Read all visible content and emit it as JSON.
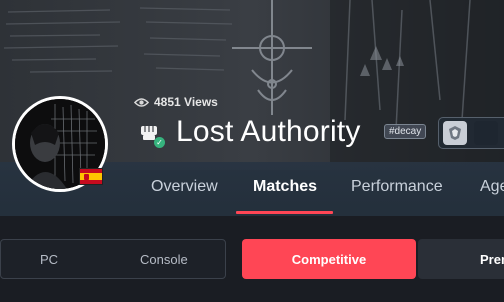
{
  "profile": {
    "views_count": "4851 Views",
    "player_name": "Lost Authority",
    "tag": "#decay",
    "flag_country": "Spain",
    "verified": true
  },
  "nav": {
    "tabs": [
      {
        "label": "Overview",
        "active": false
      },
      {
        "label": "Matches",
        "active": true
      },
      {
        "label": "Performance",
        "active": false
      },
      {
        "label": "Age",
        "active": false
      }
    ]
  },
  "filters": {
    "platforms": [
      {
        "label": "PC"
      },
      {
        "label": "Console"
      }
    ],
    "modes": [
      {
        "label": "Competitive",
        "active": true
      },
      {
        "label": "Prem",
        "active": false
      }
    ]
  },
  "colors": {
    "accent": "#ff4655",
    "nav_bg": "#26323e",
    "page_bg": "#1a1d23",
    "verified": "#36b37e"
  },
  "icons": [
    "eye-icon",
    "fist-icon",
    "check-icon",
    "flag-spain-icon",
    "badge-icon"
  ]
}
